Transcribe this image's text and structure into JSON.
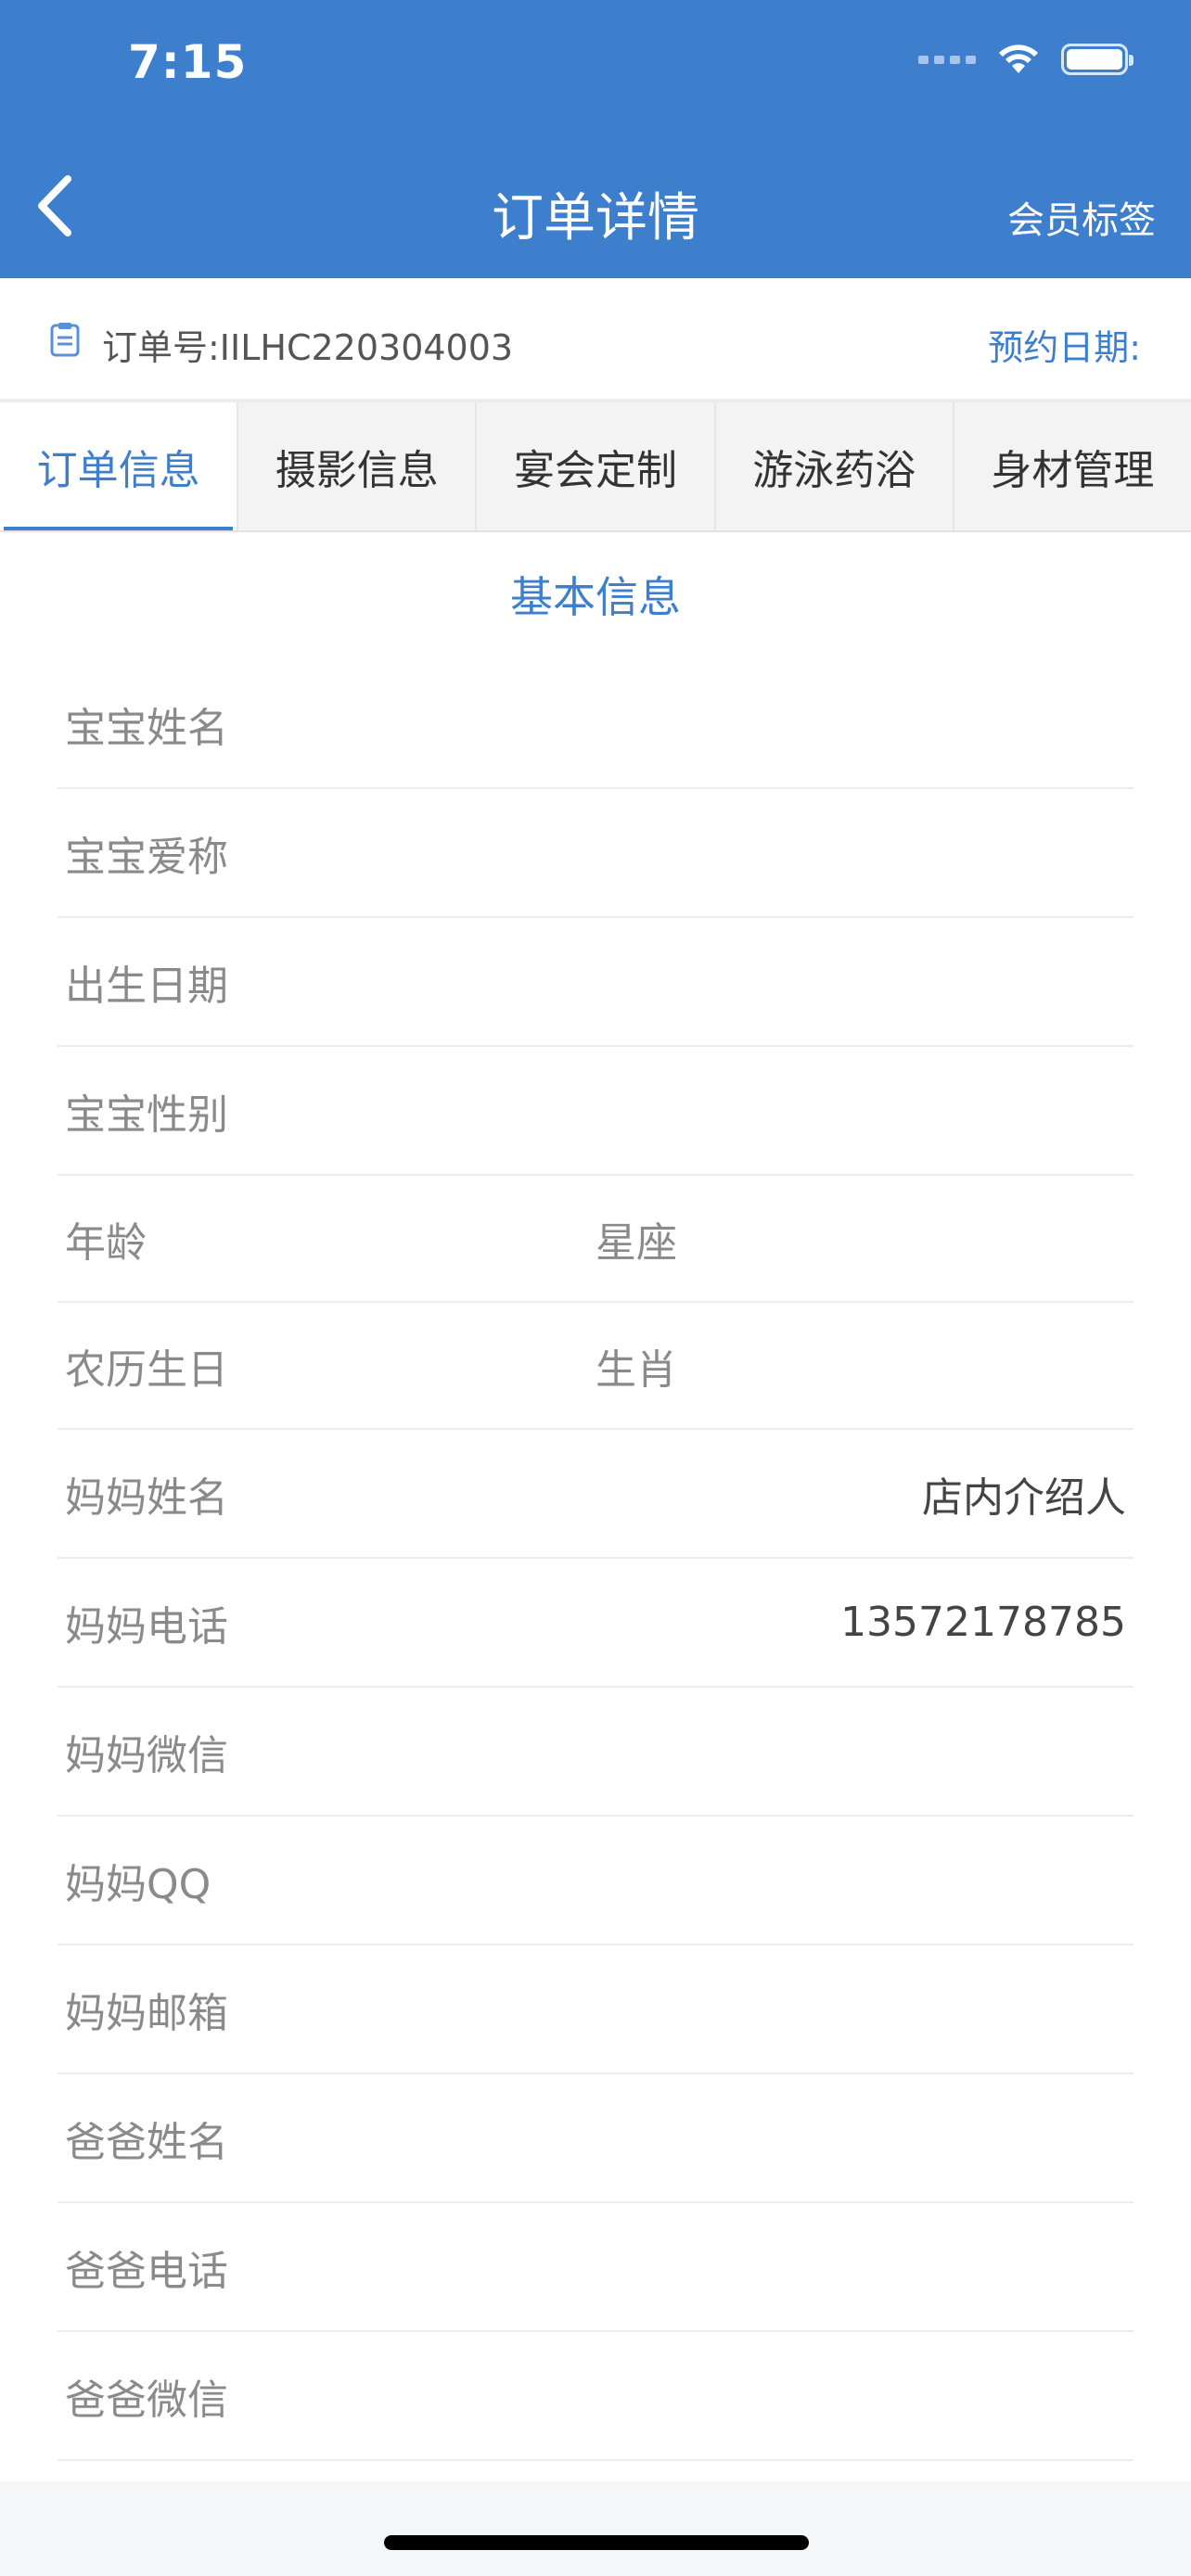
{
  "status_bar": {
    "time": "7:15"
  },
  "header": {
    "title": "订单详情",
    "member_tags": "会员标签"
  },
  "order": {
    "order_no": "订单号:IILHC220304003",
    "booking_date": "预约日期:"
  },
  "tabs": [
    {
      "label": "订单信息",
      "active": true
    },
    {
      "label": "摄影信息",
      "active": false
    },
    {
      "label": "宴会定制",
      "active": false
    },
    {
      "label": "游泳药浴",
      "active": false
    },
    {
      "label": "身材管理",
      "active": false
    }
  ],
  "section": {
    "title": "基本信息"
  },
  "fields": {
    "baby_name": "宝宝姓名",
    "baby_nickname": "宝宝爱称",
    "birth_date": "出生日期",
    "baby_gender": "宝宝性别",
    "age": "年龄",
    "constellation": "星座",
    "lunar_birthday": "农历生日",
    "zodiac": "生肖",
    "mother_name": "妈妈姓名",
    "mother_name_value": "店内介绍人",
    "mother_phone": "妈妈电话",
    "mother_phone_value": "13572178785",
    "mother_wechat": "妈妈微信",
    "mother_qq": "妈妈QQ",
    "mother_email": "妈妈邮箱",
    "father_name": "爸爸姓名",
    "father_phone": "爸爸电话",
    "father_wechat": "爸爸微信"
  },
  "colors": {
    "header_bg": "#3d7fcc",
    "accent": "#3d7fcc"
  }
}
